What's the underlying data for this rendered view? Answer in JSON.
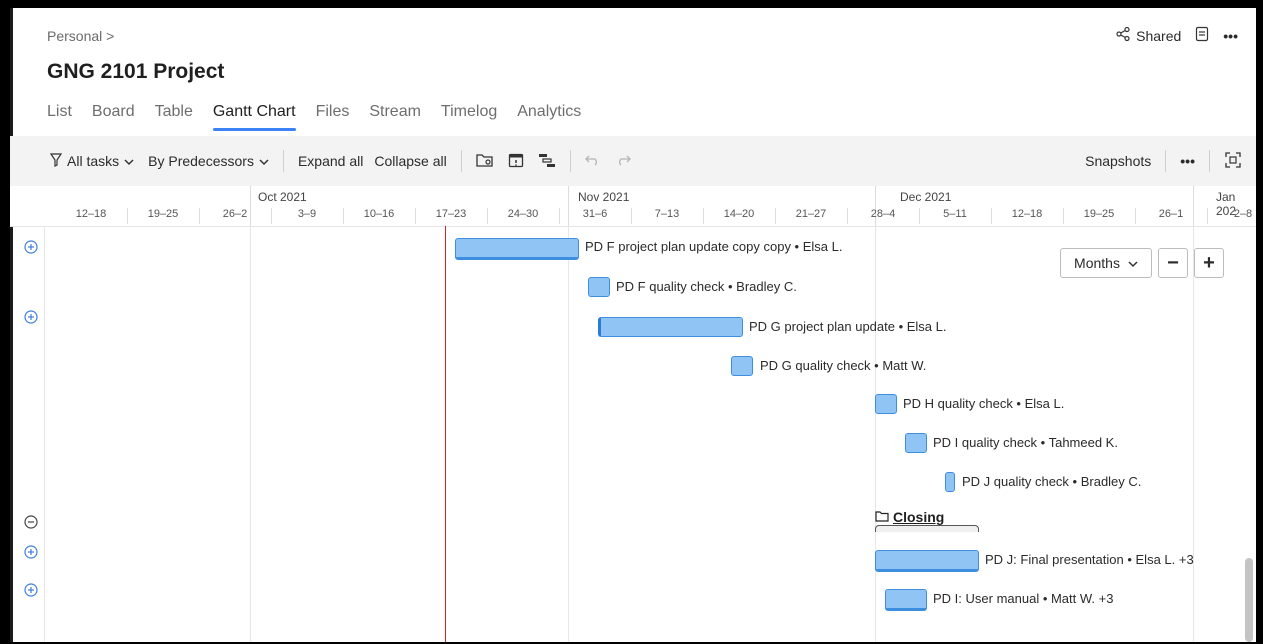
{
  "breadcrumb": "Personal >",
  "project_title": "GNG 2101 Project",
  "header_actions": {
    "shared_label": "Shared",
    "more_label": "•••"
  },
  "tabs": [
    {
      "label": "List",
      "active": false
    },
    {
      "label": "Board",
      "active": false
    },
    {
      "label": "Table",
      "active": false
    },
    {
      "label": "Gantt Chart",
      "active": true
    },
    {
      "label": "Files",
      "active": false
    },
    {
      "label": "Stream",
      "active": false
    },
    {
      "label": "Timelog",
      "active": false
    },
    {
      "label": "Analytics",
      "active": false
    }
  ],
  "toolbar": {
    "all_tasks": "All tasks",
    "by_predecessors": "By Predecessors",
    "expand_all": "Expand all",
    "collapse_all": "Collapse all",
    "snapshots": "Snapshots",
    "more": "•••"
  },
  "timeline": {
    "months": [
      "Oct 2021",
      "Nov 2021",
      "Dec 2021",
      "Jan 202"
    ],
    "weeks": [
      "12–18",
      "19–25",
      "26–2",
      "3–9",
      "10–16",
      "17–23",
      "24–30",
      "31–6",
      "7–13",
      "14–20",
      "21–27",
      "28–4",
      "5–11",
      "12–18",
      "19–25",
      "26–1",
      "2–8"
    ]
  },
  "tasks": [
    {
      "label": "PD F project plan update copy copy • Elsa L.",
      "expand": "plus"
    },
    {
      "label": "PD F quality check • Bradley C.",
      "expand": ""
    },
    {
      "label": "PD G project plan update • Elsa L.",
      "expand": "plus"
    },
    {
      "label": "PD G quality check • Matt W.",
      "expand": ""
    },
    {
      "label": "PD H quality check • Elsa L.",
      "expand": ""
    },
    {
      "label": "PD I quality check • Tahmeed K.",
      "expand": ""
    },
    {
      "label": "PD J quality check • Bradley C.",
      "expand": ""
    },
    {
      "label": "Closing",
      "expand": "minus"
    },
    {
      "label": "PD J: Final presentation • Elsa L. +3",
      "expand": "plus"
    },
    {
      "label": "PD I: User manual • Matt W. +3",
      "expand": "plus"
    }
  ],
  "zoom": {
    "scale": "Months",
    "minus": "−",
    "plus": "+"
  },
  "colors": {
    "accent": "#3b82f6",
    "bar_fill": "#90c4f5",
    "bar_border": "#3e8ee0",
    "today_line": "#c62828"
  }
}
